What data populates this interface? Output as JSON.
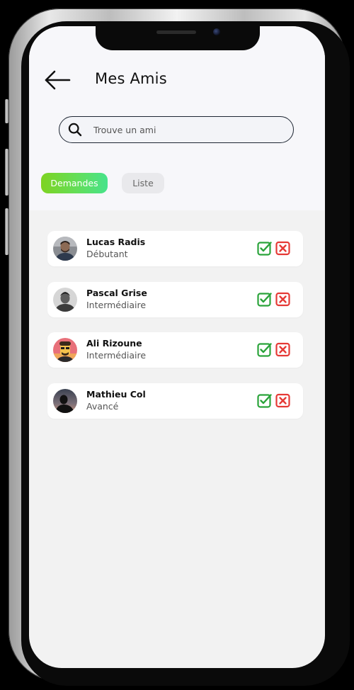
{
  "header": {
    "title": "Mes Amis"
  },
  "search": {
    "placeholder": "Trouve un ami",
    "value": ""
  },
  "tabs": [
    {
      "label": "Demandes",
      "active": true
    },
    {
      "label": "Liste",
      "active": false
    }
  ],
  "friends": [
    {
      "name": "Lucas Radis",
      "level": "Débutant"
    },
    {
      "name": "Pascal Grise",
      "level": "Intermédiaire"
    },
    {
      "name": "Ali Rizoune",
      "level": "Intermédiaire"
    },
    {
      "name": "Mathieu Col",
      "level": "Avancé"
    }
  ],
  "icons": {
    "back": "arrow-left-icon",
    "search": "search-icon",
    "accept": "check-square-icon",
    "decline": "x-square-icon"
  },
  "colors": {
    "accent_start": "#7ed321",
    "accent_end": "#47e38b",
    "accept": "#2aa33a",
    "decline": "#e53935",
    "background": "#f2f2f2"
  }
}
